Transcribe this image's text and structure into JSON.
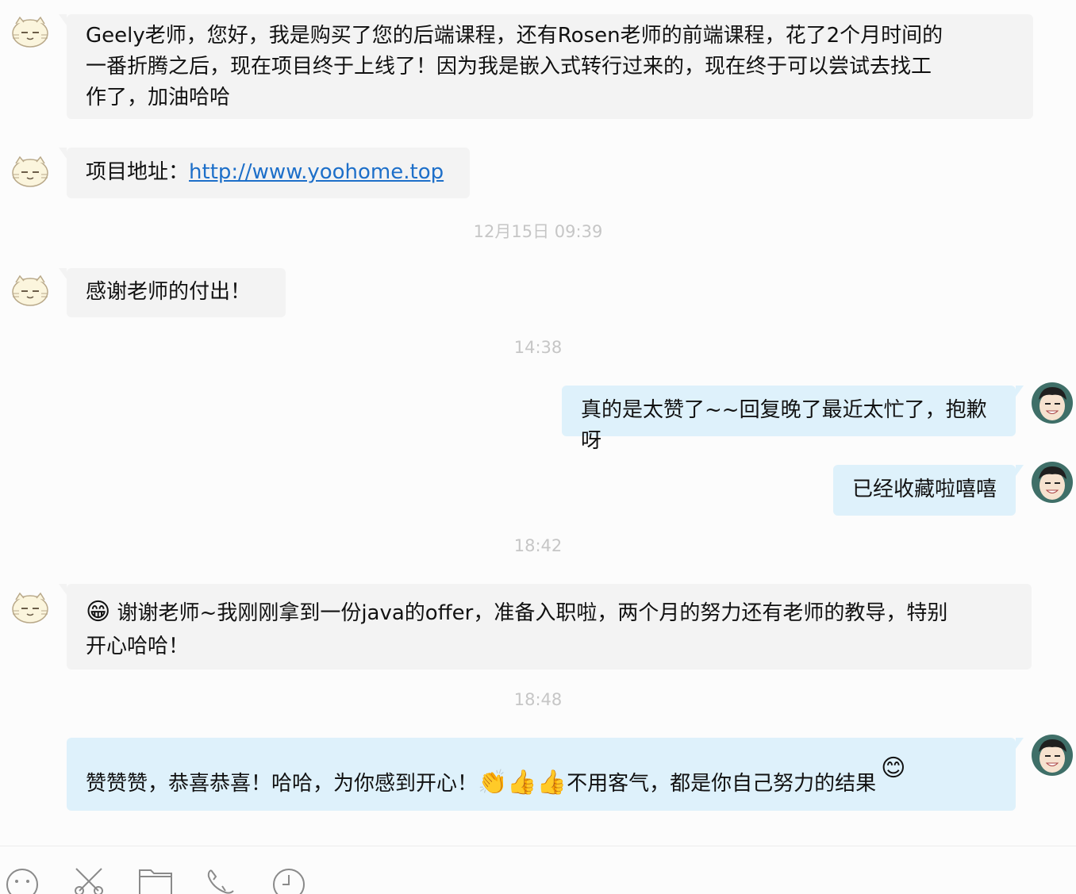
{
  "colors": {
    "incoming_bubble": "#f3f3f3",
    "outgoing_bubble": "#def1fb",
    "link": "#1d6fc9",
    "timestamp": "#c6c6c6"
  },
  "messages": {
    "m1": {
      "line1": "Geely老师，您好，我是购买了您的后端课程，还有Rosen老师的前端课程，花了2个月时间的",
      "line2": "一番折腾之后，现在项目终于上线了！因为我是嵌入式转行过来的，现在终于可以尝试去找工",
      "line3": "作了，加油哈哈"
    },
    "m2": {
      "prefix": "项目地址：",
      "link": "http://www.yoohome.top"
    },
    "t1": "12月15日  09:39",
    "m3": "感谢老师的付出！",
    "t2": "14:38",
    "m4": "真的是太赞了~~回复晚了最近太忙了，抱歉呀",
    "m5": "已经收藏啦嘻嘻",
    "t3": "18:42",
    "m6": {
      "emoji": "😁",
      "line1": " 谢谢老师~我刚刚拿到一份java的offer，准备入职啦，两个月的努力还有老师的教导，特别",
      "line2": "开心哈哈！"
    },
    "t4": "18:48",
    "m7": {
      "text1": "赞赞赞，恭喜恭喜！哈哈，为你感到开心！",
      "emoji1": "👏👍👍",
      "text2": "不用客气，都是你自己努力的结果",
      "emoji2": "😊"
    }
  },
  "toolbar": {
    "icons": [
      "smiley-icon",
      "scissors-icon",
      "folder-icon",
      "phone-icon",
      "clock-icon"
    ]
  }
}
